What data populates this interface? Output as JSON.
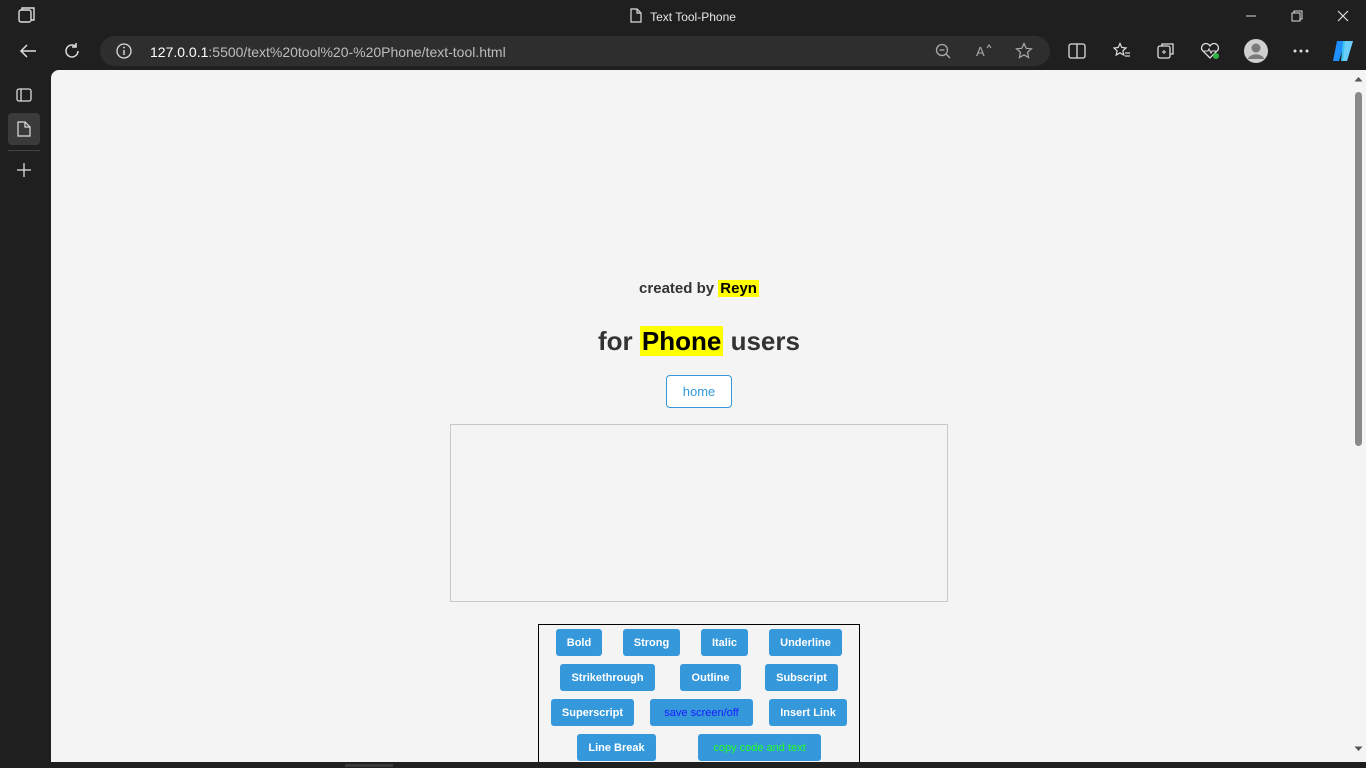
{
  "window": {
    "title": "Text Tool-Phone"
  },
  "browser": {
    "url_host": "127.0.0.1",
    "url_rest": ":5500/text%20tool%20-%20Phone/text-tool.html"
  },
  "page": {
    "created_prefix": "created by",
    "created_name": "Reyn",
    "heading_prefix": "for",
    "heading_highlight": "Phone",
    "heading_suffix": "users",
    "home_label": "home",
    "tools": {
      "bold": "Bold",
      "strong": "Strong",
      "italic": "Italic",
      "underline": "Underline",
      "strikethrough": "Strikethrough",
      "outline": "Outline",
      "subscript": "Subscript",
      "superscript": "Superscript",
      "save_screen": "save screen/off",
      "insert_link": "Insert Link",
      "line_break": "Line Break",
      "copy_code": "copy code and text"
    }
  },
  "colors": {
    "accent": "#3498db",
    "highlight": "#ffff00"
  }
}
